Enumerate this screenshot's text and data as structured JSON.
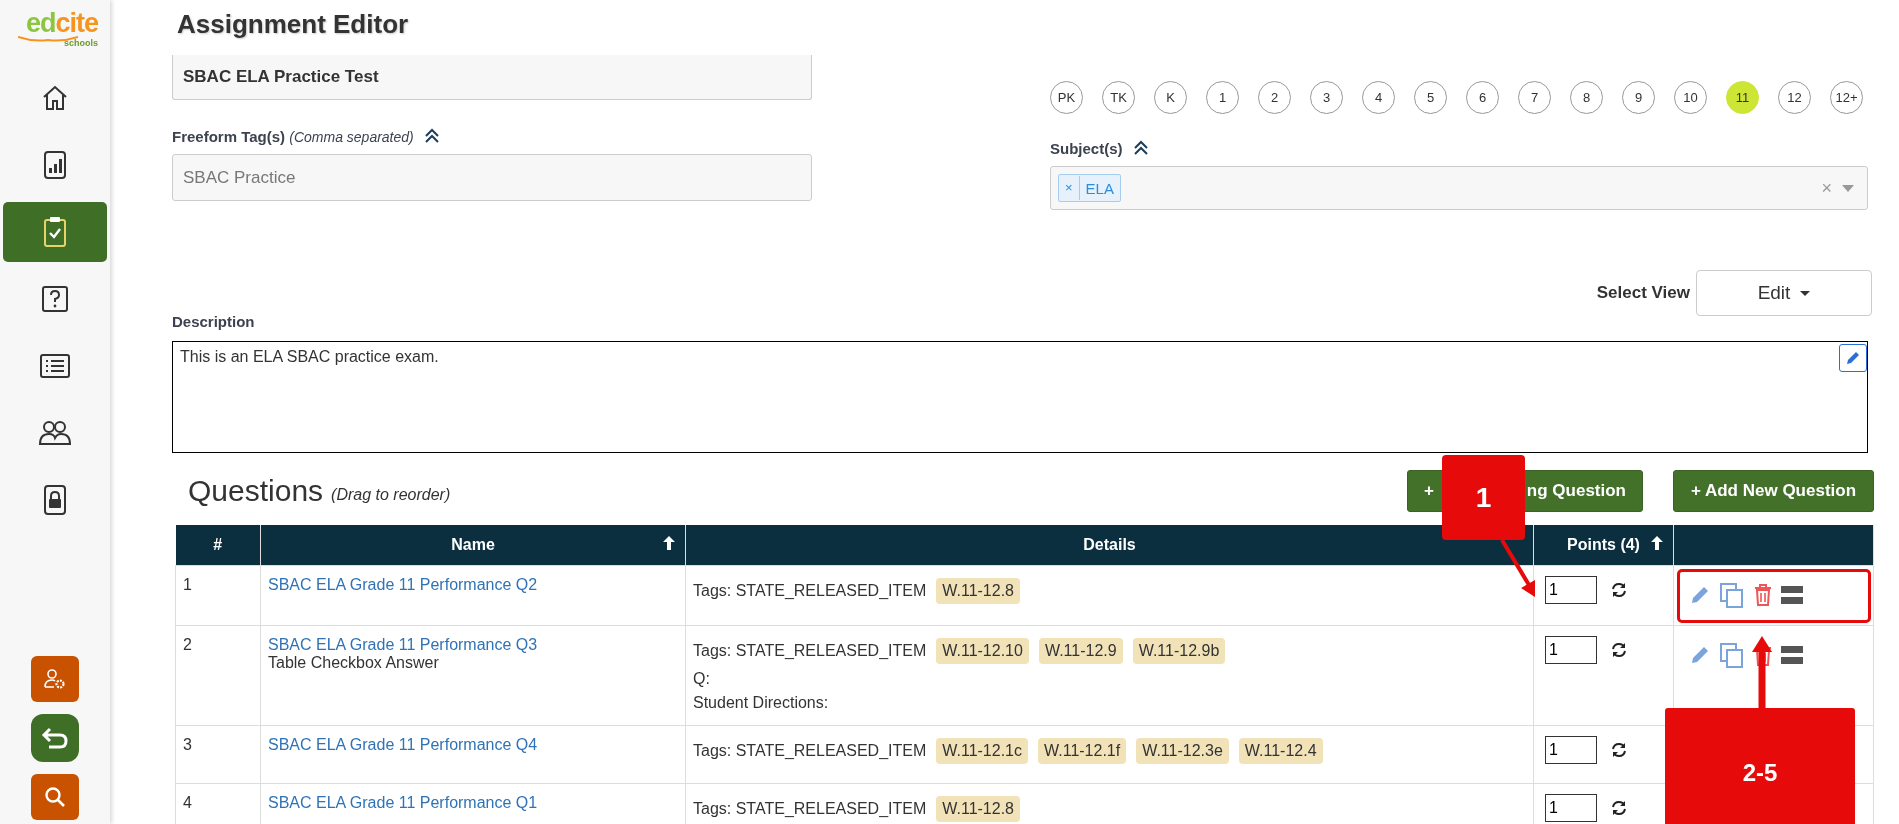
{
  "sidebar": {
    "logo": {
      "brand_parts": [
        "ed",
        "cite"
      ],
      "tagline": "schools"
    },
    "items": [
      {
        "kind": "home",
        "selected": false
      },
      {
        "kind": "report",
        "selected": false
      },
      {
        "kind": "assignment",
        "selected": true
      },
      {
        "kind": "question",
        "selected": false
      },
      {
        "kind": "list",
        "selected": false
      },
      {
        "kind": "people",
        "selected": false
      },
      {
        "kind": "lock",
        "selected": false
      }
    ],
    "bottom_buttons": [
      {
        "kind": "user-settings",
        "color": "#c85200"
      },
      {
        "kind": "back",
        "color": "#3f6e26"
      },
      {
        "kind": "search",
        "color": "#c85200"
      }
    ]
  },
  "header": {
    "title": "Assignment Editor"
  },
  "title_field": {
    "value": "SBAC ELA Practice Test"
  },
  "tags": {
    "label": "Freeform Tag(s)",
    "hint": "(Comma separated)",
    "placeholder": "SBAC Practice"
  },
  "grades": [
    {
      "label": "PK",
      "selected": false
    },
    {
      "label": "TK",
      "selected": false
    },
    {
      "label": "K",
      "selected": false
    },
    {
      "label": "1",
      "selected": false
    },
    {
      "label": "2",
      "selected": false
    },
    {
      "label": "3",
      "selected": false
    },
    {
      "label": "4",
      "selected": false
    },
    {
      "label": "5",
      "selected": false
    },
    {
      "label": "6",
      "selected": false
    },
    {
      "label": "7",
      "selected": false
    },
    {
      "label": "8",
      "selected": false
    },
    {
      "label": "9",
      "selected": false
    },
    {
      "label": "10",
      "selected": false
    },
    {
      "label": "11",
      "selected": true
    },
    {
      "label": "12",
      "selected": false
    },
    {
      "label": "12+",
      "selected": false
    }
  ],
  "subjects": {
    "label": "Subject(s)",
    "chips": [
      {
        "remove": "×",
        "label": "ELA"
      }
    ],
    "clear": "×"
  },
  "view": {
    "label": "Select View",
    "value": "Edit"
  },
  "description": {
    "label": "Description",
    "value": "This is an ELA SBAC practice exam."
  },
  "questions": {
    "title": "Questions",
    "hint": "(Drag to reorder)",
    "add_existing": {
      "visible_start": "+",
      "visible_end": "ng Question"
    },
    "add_new": "+ Add New Question"
  },
  "table": {
    "columns": [
      {
        "label": "#",
        "sortable": false
      },
      {
        "label": "Name",
        "sortable": true
      },
      {
        "label": "Details",
        "sortable": false
      },
      {
        "label": "Points (4)",
        "sortable": true
      }
    ],
    "rows": [
      {
        "number": "1",
        "name": "SBAC ELA Grade 11 Performance Q2",
        "tags_label": "Tags: STATE_RELEASED_ITEM",
        "standards": [
          "W.11-12.8"
        ],
        "points": "1",
        "actions_visible": true,
        "highlighted": true
      },
      {
        "number": "2",
        "name": "SBAC ELA Grade 11 Performance Q3",
        "subtitle": "Table Checkbox Answer",
        "tags_label": "Tags: STATE_RELEASED_ITEM",
        "standards": [
          "W.11-12.10",
          "W.11-12.9",
          "W.11-12.9b"
        ],
        "extra_lines": [
          "Q:",
          "Student Directions:"
        ],
        "points": "1",
        "actions_visible": true,
        "highlighted": false
      },
      {
        "number": "3",
        "name": "SBAC ELA Grade 11 Performance Q4",
        "tags_label": "Tags: STATE_RELEASED_ITEM",
        "standards": [
          "W.11-12.1c",
          "W.11-12.1f",
          "W.11-12.3e",
          "W.11-12.4"
        ],
        "points": "1",
        "highlighted": false
      },
      {
        "number": "4",
        "name": "SBAC ELA Grade 11 Performance Q1",
        "tags_label": "Tags: STATE_RELEASED_ITEM",
        "standards": [
          "W.11-12.8"
        ],
        "points": "1",
        "highlighted": false
      }
    ]
  },
  "callouts": [
    {
      "kind": "down-arrow",
      "text": "1"
    },
    {
      "kind": "up-arrow",
      "text": "2-5"
    }
  ]
}
